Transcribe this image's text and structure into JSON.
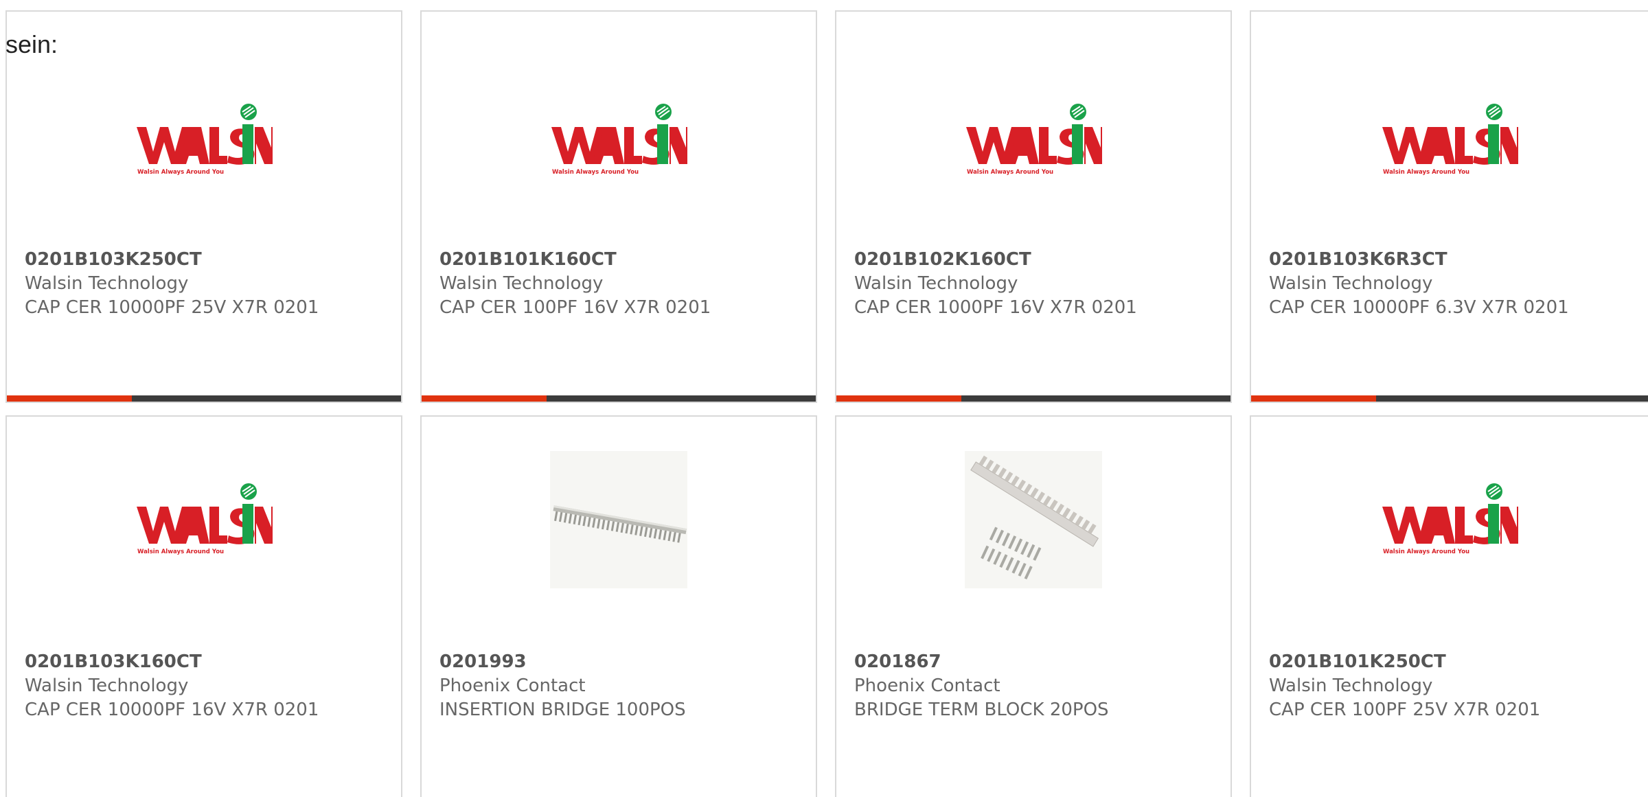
{
  "intro_text": "sein:",
  "colors": {
    "accent": "#e0330f",
    "bar": "#3c3c3c",
    "logo_red": "#d81f26",
    "logo_green": "#1aa24a"
  },
  "logo": {
    "brand_text": "WALSIN",
    "tagline": "Walsin Always Around You"
  },
  "products": [
    {
      "part": "0201B103K250CT",
      "manufacturer": "Walsin Technology",
      "description": "CAP CER 10000PF 25V X7R 0201",
      "image": "walsin-logo"
    },
    {
      "part": "0201B101K160CT",
      "manufacturer": "Walsin Technology",
      "description": "CAP CER 100PF 16V X7R 0201",
      "image": "walsin-logo"
    },
    {
      "part": "0201B102K160CT",
      "manufacturer": "Walsin Technology",
      "description": "CAP CER 1000PF 16V X7R 0201",
      "image": "walsin-logo"
    },
    {
      "part": "0201B103K6R3CT",
      "manufacturer": "Walsin Technology",
      "description": "CAP CER 10000PF 6.3V X7R 0201",
      "image": "walsin-logo"
    },
    {
      "part": "0201B103K160CT",
      "manufacturer": "Walsin Technology",
      "description": "CAP CER 10000PF 16V X7R 0201",
      "image": "walsin-logo"
    },
    {
      "part": "0201993",
      "manufacturer": "Phoenix Contact",
      "description": "INSERTION BRIDGE 100POS",
      "image": "insertion-bridge-photo"
    },
    {
      "part": "0201867",
      "manufacturer": "Phoenix Contact",
      "description": "BRIDGE TERM BLOCK 20POS",
      "image": "bridge-terminal-block-photo"
    },
    {
      "part": "0201B101K250CT",
      "manufacturer": "Walsin Technology",
      "description": "CAP CER 100PF 25V X7R 0201",
      "image": "walsin-logo"
    }
  ]
}
